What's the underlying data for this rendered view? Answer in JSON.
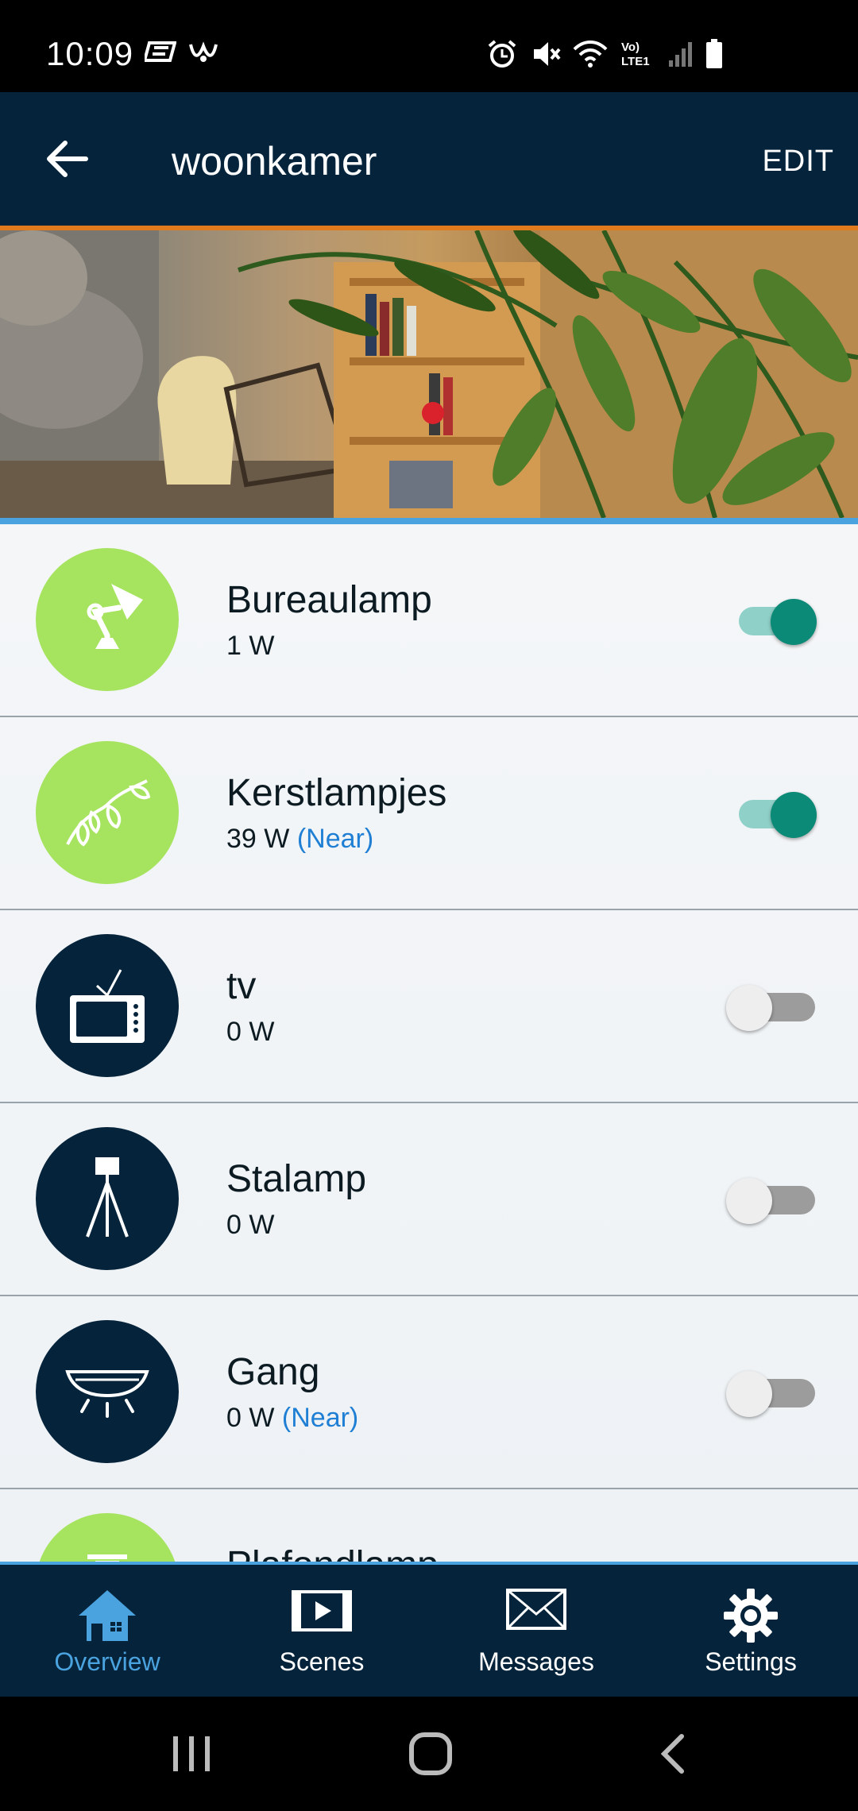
{
  "status_bar": {
    "time": "10:09",
    "icons": [
      "app-notification-icon",
      "app-notification-icon-2",
      "alarm-icon",
      "mute-icon",
      "wifi-icon",
      "volte-icon",
      "signal-icon",
      "battery-icon"
    ],
    "volte_label": "Vo)\nLTE1"
  },
  "app_bar": {
    "title": "woonkamer",
    "edit_label": "EDIT",
    "accent_color": "#e07a1c",
    "background_color": "#05233a"
  },
  "devices": [
    {
      "name": "Bureaulamp",
      "power": "1 W",
      "near": "",
      "on": true,
      "icon": "desk-lamp-icon"
    },
    {
      "name": "Kerstlampjes",
      "power": "39 W",
      "near": "(Near)",
      "on": true,
      "icon": "string-lights-icon"
    },
    {
      "name": "tv",
      "power": "0 W",
      "near": "",
      "on": false,
      "icon": "tv-icon"
    },
    {
      "name": "Stalamp",
      "power": "0 W",
      "near": "",
      "on": false,
      "icon": "floor-lamp-icon"
    },
    {
      "name": "Gang",
      "power": "0 W",
      "near": "(Near)",
      "on": false,
      "icon": "ceiling-light-icon"
    },
    {
      "name": "Plafondlamp",
      "power": "",
      "near": "",
      "on": false,
      "icon": "pendant-lamp-icon"
    }
  ],
  "bottom_nav": {
    "items": [
      {
        "label": "Overview",
        "icon": "home-icon",
        "active": true
      },
      {
        "label": "Scenes",
        "icon": "scenes-icon",
        "active": false
      },
      {
        "label": "Messages",
        "icon": "envelope-icon",
        "active": false
      },
      {
        "label": "Settings",
        "icon": "gear-icon",
        "active": false
      }
    ]
  }
}
